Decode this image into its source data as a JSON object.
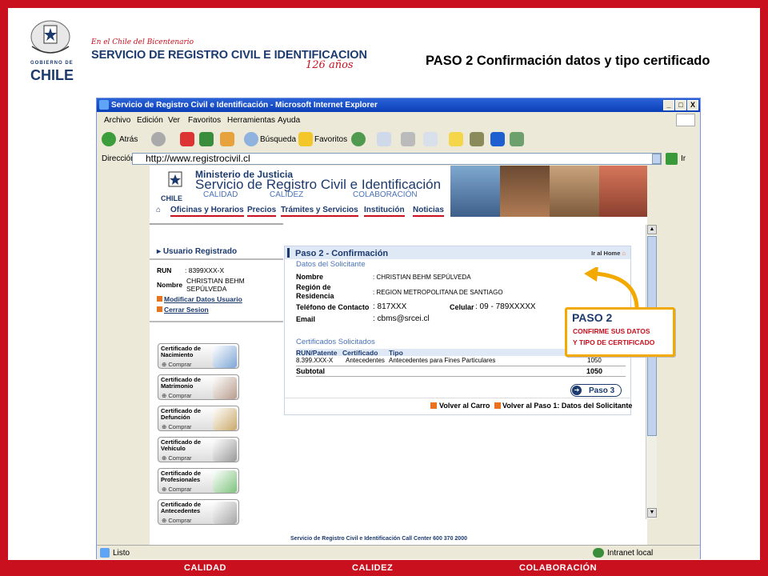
{
  "header": {
    "brand_subtitle": "En el Chile del Bicentenario",
    "brand_title": "SERVICIO DE REGISTRO CIVIL E IDENTIFICACION",
    "brand_years": "126 años",
    "gobierno": "GOBIERNO DE",
    "chile": "CHILE",
    "slide_title": "PASO 2 Confirmación datos y tipo certificado"
  },
  "window": {
    "title": "Servicio de Registro Civil e Identificación - Microsoft Internet Explorer",
    "buttons": [
      "_",
      "□",
      "X"
    ],
    "menu": [
      "Archivo",
      "Edición",
      "Ver",
      "Favoritos",
      "Herramientas",
      "Ayuda"
    ],
    "toolbar": {
      "back": "Atrás",
      "search": "Búsqueda",
      "favorites": "Favoritos"
    },
    "address_label": "Dirección",
    "address_value": "http://www.registrocivil.cl",
    "go_label": "Ir",
    "status_left": "Listo",
    "status_right": "Intranet local"
  },
  "site": {
    "ministry": "Ministerio de Justicia",
    "service": "Servicio de Registro Civil e Identificación",
    "tags": [
      "CALIDAD",
      "CALIDEZ",
      "COLABORACIÓN"
    ],
    "nav": [
      "Oficinas y Horarios",
      "Precios",
      "Trámites y Servicios",
      "Institución",
      "Noticias"
    ],
    "footer": "Servicio de Registro Civil e Identificación   Call Center 600 370 2000"
  },
  "sidebar": {
    "title": "Usuario Registrado",
    "run_label": "RUN",
    "run_value": ": 8399XXX-X",
    "name_label": "Nombre",
    "name_value_1": "CHRISTIAN BEHM",
    "name_value_2": "SEPÚLVEDA",
    "link_modify": "Modificar Datos Usuario",
    "link_logout": "Cerrar Sesion",
    "buy_label": "Comprar",
    "certificates": [
      {
        "line1": "Certificado de",
        "line2": "Nacimiento",
        "color": "#7ea6d6"
      },
      {
        "line1": "Certificado de",
        "line2": "Matrimonio",
        "color": "#b89c8c"
      },
      {
        "line1": "Certificado de",
        "line2": "Defunción",
        "color": "#c9a96a"
      },
      {
        "line1": "Certificado de",
        "line2": "Vehículo",
        "color": "#9a9a9a"
      },
      {
        "line1": "Certificado de",
        "line2": "Profesionales",
        "color": "#7ec27e"
      },
      {
        "line1": "Certificado de",
        "line2": "Antecedentes",
        "color": "#a6a6a6"
      }
    ]
  },
  "panel": {
    "title": "Paso 2 - Confirmación",
    "home_link": "Ir al Home",
    "applicant_section": "Datos del Solicitante",
    "fields": {
      "nombre_label": "Nombre",
      "nombre_value": ": CHRISTIAN BEHM SEPÚLVEDA",
      "region_label_1": "Región de",
      "region_label_2": "Residencia",
      "region_value": ": REGION METROPOLITANA DE SANTIAGO",
      "phone_label": "Teléfono de Contacto",
      "phone_value": ": 817XXX",
      "mobile_label": "Celular",
      "mobile_value": ": 09 - 789XXXXX",
      "email_label": "Email",
      "email_value": ": cbms@srcei.cl"
    },
    "requested_section": "Certificados Solicitados",
    "table_headers": [
      "RUN/Patente",
      "Certificado",
      "Tipo"
    ],
    "row": {
      "run": "8.399.XXX-X",
      "cert": "Antecedentes",
      "type": "Antecedentes para Fines Particulares",
      "price": "1050"
    },
    "subtotal_label": "Subtotal",
    "subtotal_value": "1050",
    "next_button": "Paso 3",
    "back_cart": "Volver al Carro",
    "back_step1": "Volver al Paso 1: Datos del Solicitante"
  },
  "callout": {
    "title": "PASO 2",
    "line1": "CONFIRME SUS DATOS",
    "line2": "Y TIPO DE CERTIFICADO"
  },
  "footer_bar": [
    "CALIDAD",
    "CALIDEZ",
    "COLABORACIÓN"
  ],
  "colors": {
    "brand_red": "#c8101e",
    "brand_blue": "#1c3a6e",
    "callout_border": "#f2a900"
  }
}
